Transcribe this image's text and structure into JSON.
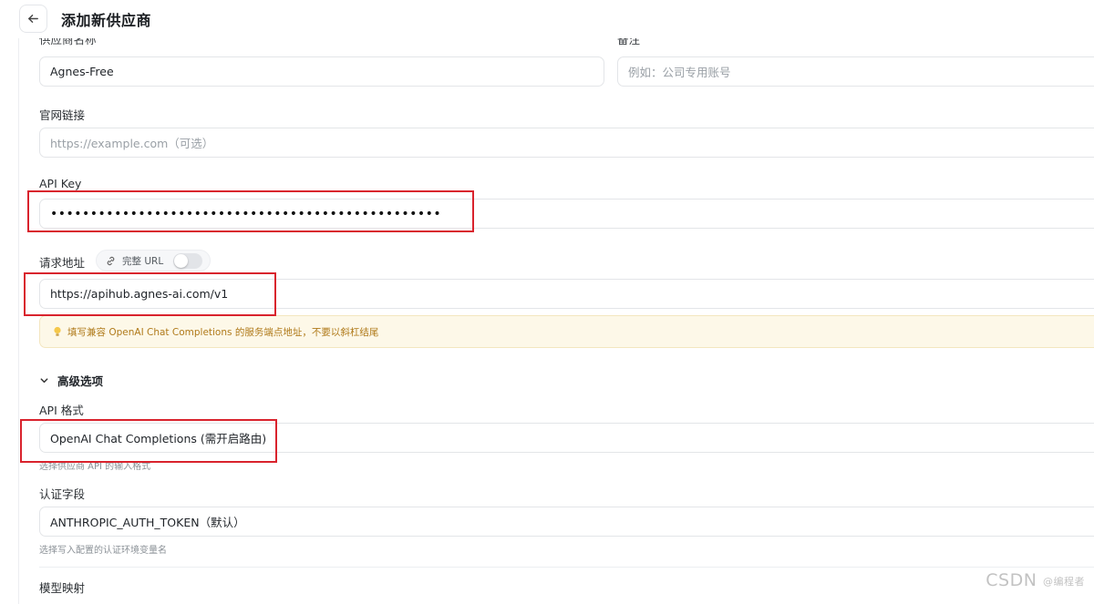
{
  "header": {
    "title": "添加新供应商",
    "back_icon": "arrow-left-icon"
  },
  "form": {
    "name": {
      "label": "供应商名称",
      "value": "Agnes-Free"
    },
    "note": {
      "label": "备注",
      "placeholder": "例如：公司专用账号"
    },
    "website": {
      "label": "官网链接",
      "placeholder": "https://example.com（可选）"
    },
    "api_key": {
      "label": "API Key",
      "masked_value": "•••••••••••••••••••••••••••••••••••••••••••••••••"
    },
    "endpoint": {
      "label": "请求地址",
      "full_url_toggle_label": "完整 URL",
      "full_url_enabled": false,
      "value": "https://apihub.agnes-ai.com/v1",
      "hint": "填写兼容 OpenAI Chat Completions 的服务端点地址，不要以斜杠结尾"
    },
    "advanced": {
      "label": "高级选项",
      "expanded": true,
      "api_format": {
        "label": "API 格式",
        "value": "OpenAI Chat Completions (需开启路由)",
        "helper": "选择供应商 API 的输入格式"
      },
      "auth_field": {
        "label": "认证字段",
        "value": "ANTHROPIC_AUTH_TOKEN（默认）",
        "helper": "选择写入配置的认证环境变量名"
      },
      "model_mapping": {
        "label": "模型映射"
      }
    }
  },
  "watermark": {
    "text": "CSDN",
    "sub": "@编程者"
  },
  "colors": {
    "highlight_border": "#d9232d",
    "hint_bg": "#fdf8e8",
    "hint_text": "#b07a1a"
  }
}
